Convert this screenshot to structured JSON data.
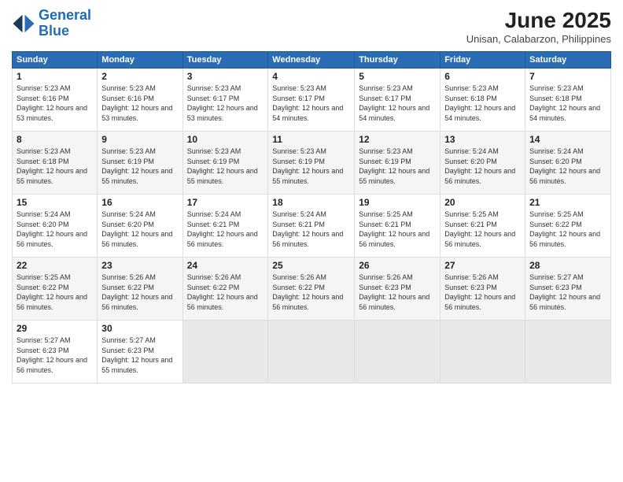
{
  "header": {
    "logo_line1": "General",
    "logo_line2": "Blue",
    "month": "June 2025",
    "location": "Unisan, Calabarzon, Philippines"
  },
  "weekdays": [
    "Sunday",
    "Monday",
    "Tuesday",
    "Wednesday",
    "Thursday",
    "Friday",
    "Saturday"
  ],
  "weeks": [
    [
      {
        "day": "1",
        "sunrise": "Sunrise: 5:23 AM",
        "sunset": "Sunset: 6:16 PM",
        "daylight": "Daylight: 12 hours and 53 minutes."
      },
      {
        "day": "2",
        "sunrise": "Sunrise: 5:23 AM",
        "sunset": "Sunset: 6:16 PM",
        "daylight": "Daylight: 12 hours and 53 minutes."
      },
      {
        "day": "3",
        "sunrise": "Sunrise: 5:23 AM",
        "sunset": "Sunset: 6:17 PM",
        "daylight": "Daylight: 12 hours and 53 minutes."
      },
      {
        "day": "4",
        "sunrise": "Sunrise: 5:23 AM",
        "sunset": "Sunset: 6:17 PM",
        "daylight": "Daylight: 12 hours and 54 minutes."
      },
      {
        "day": "5",
        "sunrise": "Sunrise: 5:23 AM",
        "sunset": "Sunset: 6:17 PM",
        "daylight": "Daylight: 12 hours and 54 minutes."
      },
      {
        "day": "6",
        "sunrise": "Sunrise: 5:23 AM",
        "sunset": "Sunset: 6:18 PM",
        "daylight": "Daylight: 12 hours and 54 minutes."
      },
      {
        "day": "7",
        "sunrise": "Sunrise: 5:23 AM",
        "sunset": "Sunset: 6:18 PM",
        "daylight": "Daylight: 12 hours and 54 minutes."
      }
    ],
    [
      {
        "day": "8",
        "sunrise": "Sunrise: 5:23 AM",
        "sunset": "Sunset: 6:18 PM",
        "daylight": "Daylight: 12 hours and 55 minutes."
      },
      {
        "day": "9",
        "sunrise": "Sunrise: 5:23 AM",
        "sunset": "Sunset: 6:19 PM",
        "daylight": "Daylight: 12 hours and 55 minutes."
      },
      {
        "day": "10",
        "sunrise": "Sunrise: 5:23 AM",
        "sunset": "Sunset: 6:19 PM",
        "daylight": "Daylight: 12 hours and 55 minutes."
      },
      {
        "day": "11",
        "sunrise": "Sunrise: 5:23 AM",
        "sunset": "Sunset: 6:19 PM",
        "daylight": "Daylight: 12 hours and 55 minutes."
      },
      {
        "day": "12",
        "sunrise": "Sunrise: 5:23 AM",
        "sunset": "Sunset: 6:19 PM",
        "daylight": "Daylight: 12 hours and 55 minutes."
      },
      {
        "day": "13",
        "sunrise": "Sunrise: 5:24 AM",
        "sunset": "Sunset: 6:20 PM",
        "daylight": "Daylight: 12 hours and 56 minutes."
      },
      {
        "day": "14",
        "sunrise": "Sunrise: 5:24 AM",
        "sunset": "Sunset: 6:20 PM",
        "daylight": "Daylight: 12 hours and 56 minutes."
      }
    ],
    [
      {
        "day": "15",
        "sunrise": "Sunrise: 5:24 AM",
        "sunset": "Sunset: 6:20 PM",
        "daylight": "Daylight: 12 hours and 56 minutes."
      },
      {
        "day": "16",
        "sunrise": "Sunrise: 5:24 AM",
        "sunset": "Sunset: 6:20 PM",
        "daylight": "Daylight: 12 hours and 56 minutes."
      },
      {
        "day": "17",
        "sunrise": "Sunrise: 5:24 AM",
        "sunset": "Sunset: 6:21 PM",
        "daylight": "Daylight: 12 hours and 56 minutes."
      },
      {
        "day": "18",
        "sunrise": "Sunrise: 5:24 AM",
        "sunset": "Sunset: 6:21 PM",
        "daylight": "Daylight: 12 hours and 56 minutes."
      },
      {
        "day": "19",
        "sunrise": "Sunrise: 5:25 AM",
        "sunset": "Sunset: 6:21 PM",
        "daylight": "Daylight: 12 hours and 56 minutes."
      },
      {
        "day": "20",
        "sunrise": "Sunrise: 5:25 AM",
        "sunset": "Sunset: 6:21 PM",
        "daylight": "Daylight: 12 hours and 56 minutes."
      },
      {
        "day": "21",
        "sunrise": "Sunrise: 5:25 AM",
        "sunset": "Sunset: 6:22 PM",
        "daylight": "Daylight: 12 hours and 56 minutes."
      }
    ],
    [
      {
        "day": "22",
        "sunrise": "Sunrise: 5:25 AM",
        "sunset": "Sunset: 6:22 PM",
        "daylight": "Daylight: 12 hours and 56 minutes."
      },
      {
        "day": "23",
        "sunrise": "Sunrise: 5:26 AM",
        "sunset": "Sunset: 6:22 PM",
        "daylight": "Daylight: 12 hours and 56 minutes."
      },
      {
        "day": "24",
        "sunrise": "Sunrise: 5:26 AM",
        "sunset": "Sunset: 6:22 PM",
        "daylight": "Daylight: 12 hours and 56 minutes."
      },
      {
        "day": "25",
        "sunrise": "Sunrise: 5:26 AM",
        "sunset": "Sunset: 6:22 PM",
        "daylight": "Daylight: 12 hours and 56 minutes."
      },
      {
        "day": "26",
        "sunrise": "Sunrise: 5:26 AM",
        "sunset": "Sunset: 6:23 PM",
        "daylight": "Daylight: 12 hours and 56 minutes."
      },
      {
        "day": "27",
        "sunrise": "Sunrise: 5:26 AM",
        "sunset": "Sunset: 6:23 PM",
        "daylight": "Daylight: 12 hours and 56 minutes."
      },
      {
        "day": "28",
        "sunrise": "Sunrise: 5:27 AM",
        "sunset": "Sunset: 6:23 PM",
        "daylight": "Daylight: 12 hours and 56 minutes."
      }
    ],
    [
      {
        "day": "29",
        "sunrise": "Sunrise: 5:27 AM",
        "sunset": "Sunset: 6:23 PM",
        "daylight": "Daylight: 12 hours and 56 minutes."
      },
      {
        "day": "30",
        "sunrise": "Sunrise: 5:27 AM",
        "sunset": "Sunset: 6:23 PM",
        "daylight": "Daylight: 12 hours and 55 minutes."
      },
      null,
      null,
      null,
      null,
      null
    ]
  ]
}
